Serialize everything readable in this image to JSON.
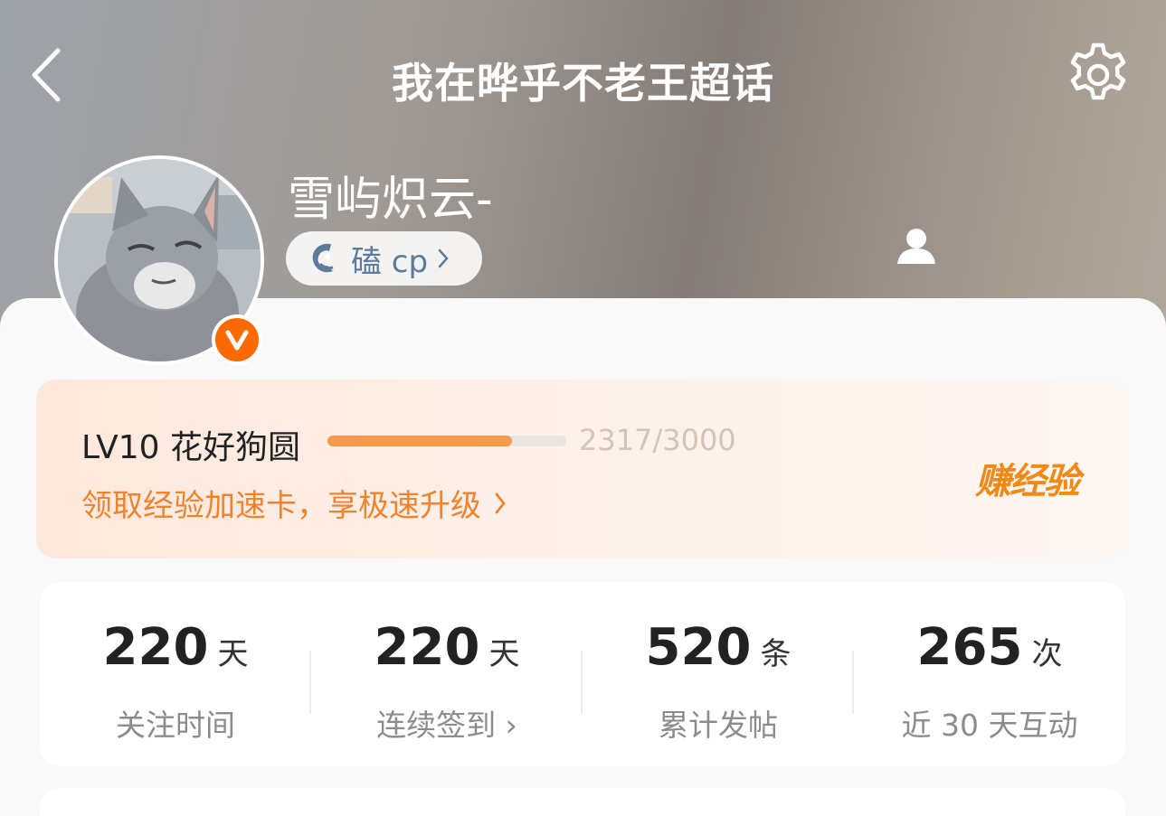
{
  "nav": {
    "back_icon": "chevron-left-icon",
    "title": "我在晔乎不老王超话",
    "settings_icon": "gear-icon"
  },
  "profile": {
    "name": "雪屿炽云-",
    "verified_badge": "V",
    "tag": {
      "icon": "fish-icon",
      "label": "磕 cp"
    },
    "person_icon": "person-icon"
  },
  "level": {
    "text": "LV10 花好狗圆",
    "progress_text": "2317/3000",
    "progress_fraction": 0.772,
    "promo": "领取经验加速卡，享极速升级",
    "earn_label": "赚经验",
    "accent_color": "#f0832e"
  },
  "stats": [
    {
      "value": "220",
      "unit": "天",
      "label": "关注时间"
    },
    {
      "value": "220",
      "unit": "天",
      "label": "连续签到 ›"
    },
    {
      "value": "520",
      "unit": "条",
      "label": "累计发帖"
    },
    {
      "value": "265",
      "unit": "次",
      "label": "近 30 天互动"
    }
  ]
}
